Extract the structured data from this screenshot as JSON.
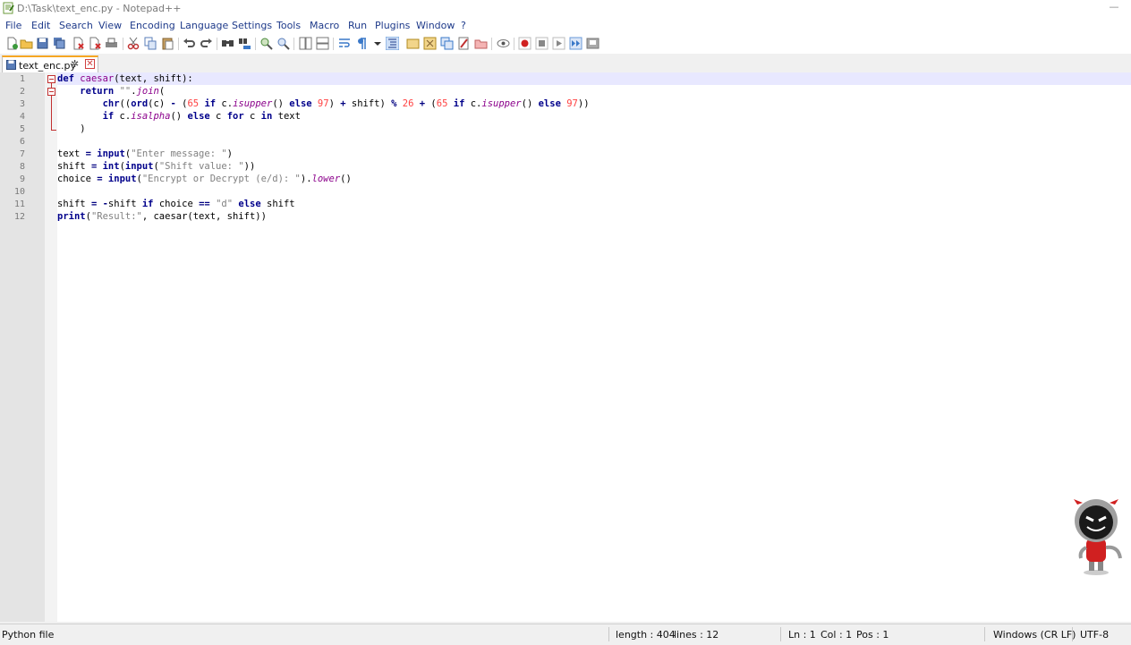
{
  "window": {
    "title": "D:\\Task\\text_enc.py - Notepad++",
    "minimize_glyph": "—"
  },
  "menu": {
    "items": [
      "File",
      "Edit",
      "Search",
      "View",
      "Encoding",
      "Language",
      "Settings",
      "Tools",
      "Macro",
      "Run",
      "Plugins",
      "Window",
      "?"
    ]
  },
  "toolbar": {
    "icons": [
      "new-file-icon",
      "open-file-icon",
      "save-icon",
      "save-all-icon",
      "close-icon",
      "close-all-icon",
      "print-icon",
      "cut-icon",
      "copy-icon",
      "paste-icon",
      "undo-icon",
      "redo-icon",
      "find-icon",
      "replace-icon",
      "zoom-in-icon",
      "zoom-out-icon",
      "sync-vertical-icon",
      "sync-horizontal-icon",
      "word-wrap-icon",
      "show-all-chars-icon",
      "indent-guide-icon",
      "user-defined-lang-icon",
      "doc-map-icon",
      "function-list-icon",
      "folder-workspace-icon",
      "doc-list-icon",
      "monitoring-icon",
      "record-macro-icon",
      "stop-record-icon",
      "playback-macro-icon",
      "run-macro-multiple-icon",
      "save-macro-icon"
    ]
  },
  "tab": {
    "label": "text_enc.py",
    "pin_glyph": "✲",
    "close_glyph": "✕"
  },
  "editor": {
    "line_numbers": [
      "1",
      "2",
      "3",
      "4",
      "5",
      "6",
      "7",
      "8",
      "9",
      "10",
      "11",
      "12"
    ],
    "lines": [
      "def caesar(text, shift):",
      "    return \"\".join(",
      "        chr((ord(c) - (65 if c.isupper() else 97) + shift) % 26 + (65 if c.isupper() else 97))",
      "        if c.isalpha() else c for c in text",
      "    )",
      "",
      "text = input(\"Enter message: \")",
      "shift = int(input(\"Shift value: \"))",
      "choice = input(\"Encrypt or Decrypt (e/d): \").lower()",
      "",
      "shift = -shift if choice == \"d\" else shift",
      "print(\"Result:\", caesar(text, shift))"
    ]
  },
  "status": {
    "file_type": "Python file",
    "length": "length : 404",
    "lines": "lines : 12",
    "ln": "Ln : 1",
    "col": "Col : 1",
    "pos": "Pos : 1",
    "eol": "Windows (CR LF)",
    "encoding": "UTF-8"
  },
  "colors": {
    "keyword": "#00008b",
    "function": "#8b008b",
    "string": "#808080",
    "number": "#ff4040",
    "current_line": "#e8e8ff",
    "tab_accent": "#f5a623"
  }
}
